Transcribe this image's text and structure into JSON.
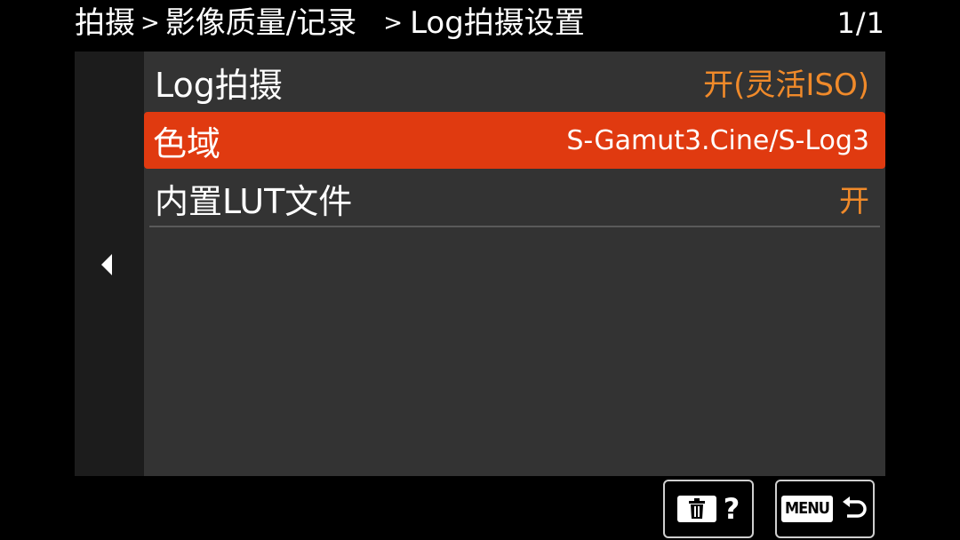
{
  "breadcrumb": {
    "items": [
      "拍摄",
      "影像质量/记录",
      "Log拍摄设置"
    ],
    "separator": ">"
  },
  "page_indicator": "1/1",
  "menu": {
    "items": [
      {
        "label": "Log拍摄",
        "value": "开(灵活ISO)",
        "selected": false
      },
      {
        "label": "色域",
        "value": "S-Gamut3.Cine/S-Log3",
        "selected": true
      },
      {
        "label": "内置LUT文件",
        "value": "开",
        "selected": false
      }
    ]
  },
  "footer": {
    "delete_help_icons": [
      "trash-icon",
      "help-icon"
    ],
    "help_glyph": "?",
    "menu_label": "MENU",
    "back_icon": "return-arrow-icon"
  },
  "colors": {
    "accent": "#e03a10",
    "value_orange": "#f08a2a",
    "panel": "#333333",
    "side_panel": "#1c1c1c"
  }
}
